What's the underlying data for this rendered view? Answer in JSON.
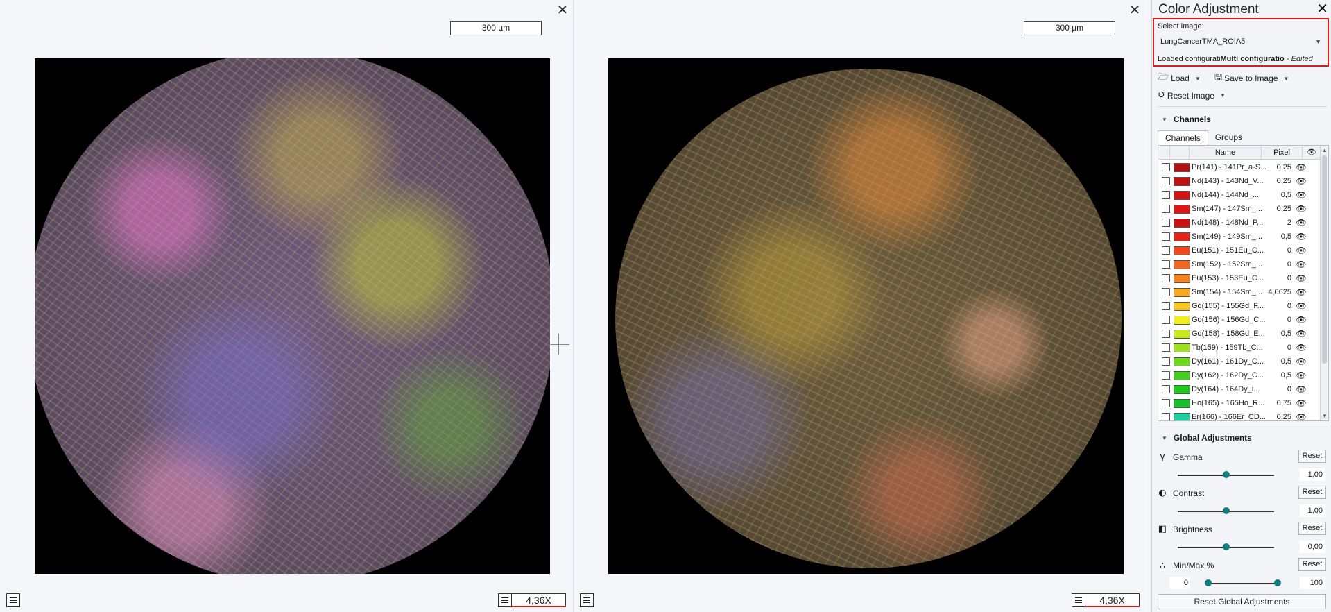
{
  "viewer_left": {
    "scale_bar": "300 µm",
    "zoom": "4,36X"
  },
  "viewer_right": {
    "scale_bar": "300 µm",
    "zoom": "4,36X"
  },
  "panel": {
    "title": "Color Adjustment",
    "select_label": "Select image:",
    "selected_image": "LungCancerTMA_ROIA5",
    "loaded_prefix": "Loaded configurati",
    "loaded_name": "Multi configuratio",
    "loaded_suffix": " - ",
    "loaded_state": "Edited",
    "toolbar": {
      "load": "Load",
      "save": "Save to Image",
      "reset": "Reset Image"
    },
    "channels_section": "Channels",
    "tabs": [
      "Channels",
      "Groups"
    ],
    "columns": {
      "name": "Name",
      "pixel": "Pixel"
    },
    "channels": [
      {
        "name": "Pr(141) - 141Pr_a-S...",
        "pixel": "0,25",
        "color": "#b40f0f"
      },
      {
        "name": "Nd(143) - 143Nd_V...",
        "pixel": "0,25",
        "color": "#c01010"
      },
      {
        "name": "Nd(144) - 144Nd_...",
        "pixel": "0,5",
        "color": "#d41212"
      },
      {
        "name": "Sm(147) - 147Sm_...",
        "pixel": "0,25",
        "color": "#e01414"
      },
      {
        "name": "Nd(148) - 148Nd_P...",
        "pixel": "2",
        "color": "#cc1010"
      },
      {
        "name": "Sm(149) - 149Sm_...",
        "pixel": "0,5",
        "color": "#e62216"
      },
      {
        "name": "Eu(151) - 151Eu_C...",
        "pixel": "0",
        "color": "#f0461a"
      },
      {
        "name": "Sm(152) - 152Sm_...",
        "pixel": "0",
        "color": "#f2661e"
      },
      {
        "name": "Eu(153) - 153Eu_C...",
        "pixel": "0",
        "color": "#f58420"
      },
      {
        "name": "Sm(154) - 154Sm_...",
        "pixel": "4,0625",
        "color": "#f8a822"
      },
      {
        "name": "Gd(155) - 155Gd_F...",
        "pixel": "0",
        "color": "#f8c820"
      },
      {
        "name": "Gd(156) - 156Gd_C...",
        "pixel": "0",
        "color": "#f6ee1a"
      },
      {
        "name": "Gd(158) - 158Gd_E...",
        "pixel": "0,5",
        "color": "#c8ea1c"
      },
      {
        "name": "Tb(159) - 159Tb_C...",
        "pixel": "0",
        "color": "#9ee21c"
      },
      {
        "name": "Dy(161) - 161Dy_C...",
        "pixel": "0,5",
        "color": "#6cd81c"
      },
      {
        "name": "Dy(162) - 162Dy_C...",
        "pixel": "0,5",
        "color": "#40d01c"
      },
      {
        "name": "Dy(164) - 164Dy_i...",
        "pixel": "0",
        "color": "#22c81e"
      },
      {
        "name": "Ho(165) - 165Ho_R...",
        "pixel": "0,75",
        "color": "#18c02e"
      },
      {
        "name": "Er(166) - 166Er_CD...",
        "pixel": "0,25",
        "color": "#1ed0a0"
      }
    ],
    "global_section": "Global Adjustments",
    "gamma": {
      "label": "Gamma",
      "value": "1,00",
      "level": 0.5
    },
    "contrast": {
      "label": "Contrast",
      "value": "1,00",
      "level": 0.5
    },
    "brightness": {
      "label": "Brightness",
      "value": "0,00",
      "level": 0.5
    },
    "minmax": {
      "label": "Min/Max %",
      "min": "0",
      "max": "100"
    },
    "reset_label": "Reset",
    "reset_global": "Reset Global Adjustments"
  }
}
